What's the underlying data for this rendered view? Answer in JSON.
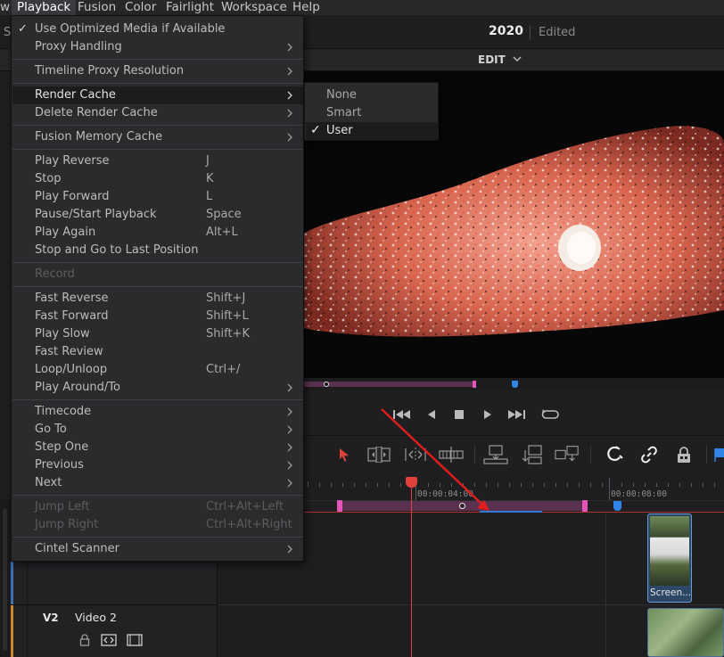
{
  "menubar": {
    "items": [
      "w",
      "Playback",
      "Fusion",
      "Color",
      "Fairlight",
      "Workspace",
      "Help"
    ],
    "active": "Playback"
  },
  "header": {
    "left_tab": "S",
    "project_title": "2020",
    "project_status": "Edited",
    "page_label": "EDIT"
  },
  "playback_menu": {
    "items": [
      {
        "label": "Use Optimized Media if Available",
        "checked": true
      },
      {
        "label": "Proxy Handling",
        "submenu": true
      },
      {
        "label": "Timeline Proxy Resolution",
        "submenu": true
      },
      {
        "label": "Render Cache",
        "submenu": true,
        "highlighted": true
      },
      {
        "label": "Delete Render Cache",
        "submenu": true
      },
      {
        "label": "Fusion Memory Cache",
        "submenu": true
      },
      {
        "label": "Play Reverse",
        "shortcut": "J"
      },
      {
        "label": "Stop",
        "shortcut": "K"
      },
      {
        "label": "Play Forward",
        "shortcut": "L"
      },
      {
        "label": "Pause/Start Playback",
        "shortcut": "Space"
      },
      {
        "label": "Play Again",
        "shortcut": "Alt+L"
      },
      {
        "label": "Stop and Go to Last Position"
      },
      {
        "label": "Record",
        "disabled": true
      },
      {
        "label": "Fast Reverse",
        "shortcut": "Shift+J"
      },
      {
        "label": "Fast Forward",
        "shortcut": "Shift+L"
      },
      {
        "label": "Play Slow",
        "shortcut": "Shift+K"
      },
      {
        "label": "Fast Review"
      },
      {
        "label": "Loop/Unloop",
        "shortcut": "Ctrl+/"
      },
      {
        "label": "Play Around/To",
        "submenu": true
      },
      {
        "label": "Timecode",
        "submenu": true
      },
      {
        "label": "Go To",
        "submenu": true
      },
      {
        "label": "Step One",
        "submenu": true
      },
      {
        "label": "Previous",
        "submenu": true
      },
      {
        "label": "Next",
        "submenu": true
      },
      {
        "label": "Jump Left",
        "shortcut": "Ctrl+Alt+Left",
        "disabled": true
      },
      {
        "label": "Jump Right",
        "shortcut": "Ctrl+Alt+Right",
        "disabled": true
      },
      {
        "label": "Cintel Scanner",
        "submenu": true
      }
    ]
  },
  "render_cache_submenu": {
    "items": [
      {
        "label": "None"
      },
      {
        "label": "Smart"
      },
      {
        "label": "User",
        "selected": true
      }
    ]
  },
  "transport": {
    "buttons": [
      "go-to-start-icon",
      "play-reverse-icon",
      "stop-icon",
      "play-icon",
      "go-to-end-icon",
      "loop-icon"
    ]
  },
  "edit_toolbar": {
    "tools": [
      "selection-icon",
      "trim-icon",
      "dynamic-trim-icon",
      "blade-icon",
      "insert-clip-icon",
      "overwrite-clip-icon",
      "replace-clip-icon",
      "snapping-icon",
      "linked-selection-icon",
      "position-lock-icon"
    ],
    "accent": "#e0413b"
  },
  "timeline": {
    "timecodes": [
      "00:00:04:00",
      "00:00:08:00"
    ],
    "clip_name": "Screen...",
    "track_v2_label": "V2",
    "track_v2_name": "Video 2",
    "playhead_color": "#e0413b",
    "in_out_color": "#e455b8"
  }
}
